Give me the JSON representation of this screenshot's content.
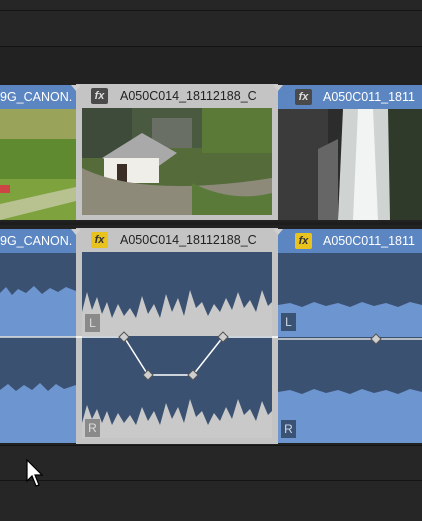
{
  "clips": {
    "left": {
      "name": "9G_CANON.",
      "audio_name": "9G_CANON."
    },
    "middle": {
      "name": "A050C014_18112188_C",
      "audio_name": "A050C014_18112188_C",
      "fx_icon": "fx"
    },
    "right": {
      "name": "A050C011_1811",
      "audio_name": "A050C011_1811",
      "fx_icon": "fx"
    }
  },
  "audio_channels": {
    "left": "L",
    "right": "R"
  },
  "colors": {
    "clip_blue": "#5b86c2",
    "selected_gray": "#c4c4c4",
    "fx_audio": "#e8c21d",
    "waveform": "#6d95cf"
  }
}
